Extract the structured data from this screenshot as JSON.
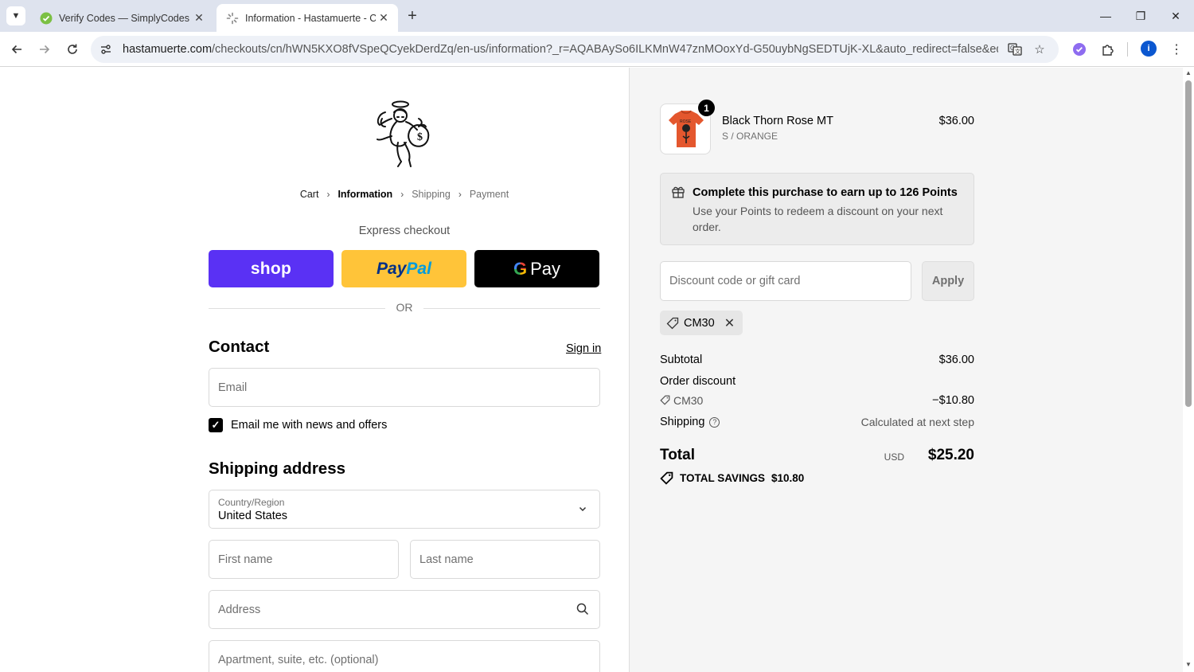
{
  "browser": {
    "tabs": [
      {
        "title": "Verify Codes — SimplyCodes",
        "active": false
      },
      {
        "title": "Information - Hastamuerte - Ch",
        "active": true
      }
    ],
    "url_host": "hastamuerte.com",
    "url_path": "/checkouts/cn/hWN5KXO8fVSpeQCyekDerdZq/en-us/information?_r=AQABAySo6ILKMnW47znMOoxYd-G50uybNgSEDTUjK-XL&auto_redirect=false&edge_redirec...",
    "profile_initial": "i"
  },
  "checkout": {
    "breadcrumb": [
      "Cart",
      "Information",
      "Shipping",
      "Payment"
    ],
    "express_checkout_label": "Express checkout",
    "express_buttons": {
      "shop": "shop",
      "paypal_1": "Pay",
      "paypal_2": "Pal",
      "gpay_g": "G",
      "gpay": "Pay"
    },
    "or_label": "OR",
    "contact_heading": "Contact",
    "sign_in_link": "Sign in",
    "email_placeholder": "Email",
    "email_news_label": "Email me with news and offers",
    "email_news_checked": true,
    "shipping_heading": "Shipping address",
    "country_label": "Country/Region",
    "country_value": "United States",
    "first_name_placeholder": "First name",
    "last_name_placeholder": "Last name",
    "address_placeholder": "Address",
    "apartment_placeholder": "Apartment, suite, etc. (optional)"
  },
  "summary": {
    "product": {
      "name": "Black Thorn Rose MT",
      "variant": "S / ORANGE",
      "price": "$36.00",
      "quantity": "1"
    },
    "points": {
      "title": "Complete this purchase to earn up to 126 Points",
      "description": "Use your Points to redeem a discount on your next order."
    },
    "discount_placeholder": "Discount code or gift card",
    "apply_label": "Apply",
    "applied_code": "CM30",
    "subtotal_label": "Subtotal",
    "subtotal_value": "$36.00",
    "order_discount_label": "Order discount",
    "discount_code": "CM30",
    "discount_value": "−$10.80",
    "shipping_label": "Shipping",
    "shipping_value": "Calculated at next step",
    "total_label": "Total",
    "currency": "USD",
    "total_value": "$25.20",
    "savings_label": "TOTAL SAVINGS",
    "savings_value": "$10.80"
  },
  "colors": {
    "shop_purple": "#5a31f4",
    "paypal_yellow": "#ffc439",
    "gpay_black": "#000000"
  }
}
